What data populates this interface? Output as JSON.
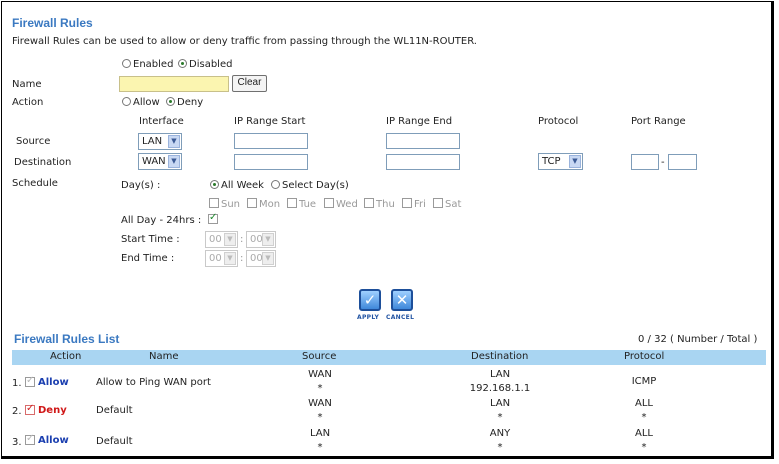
{
  "header": {
    "title": "Firewall Rules",
    "description": "Firewall Rules can be used to allow or deny traffic from passing through the WL11N-ROUTER."
  },
  "status": {
    "enabled_label": "Enabled",
    "disabled_label": "Disabled",
    "selected": "Disabled"
  },
  "name_field": {
    "label": "Name",
    "value": "",
    "clear_label": "Clear"
  },
  "action_field": {
    "label": "Action",
    "allow_label": "Allow",
    "deny_label": "Deny",
    "selected": "Deny"
  },
  "columns": {
    "interface": "Interface",
    "ip_start": "IP Range Start",
    "ip_end": "IP Range End",
    "protocol": "Protocol",
    "port_range": "Port Range"
  },
  "source": {
    "label": "Source",
    "interface": "LAN",
    "ip_start": "",
    "ip_end": ""
  },
  "destination": {
    "label": "Destination",
    "interface": "WAN",
    "ip_start": "",
    "ip_end": "",
    "protocol": "TCP",
    "port_start": "",
    "port_end": "",
    "port_sep": "-"
  },
  "schedule": {
    "label": "Schedule",
    "days_label": "Day(s) :",
    "all_week_label": "All Week",
    "select_days_label": "Select Day(s)",
    "days": [
      "Sun",
      "Mon",
      "Tue",
      "Wed",
      "Thu",
      "Fri",
      "Sat"
    ],
    "all_day_label": "All Day - 24hrs :",
    "start_label": "Start Time :",
    "end_label": "End Time :",
    "time_hour": "00",
    "time_min": "00",
    "time_sep": ":"
  },
  "buttons": {
    "apply": "APPLY",
    "cancel": "CANCEL"
  },
  "list": {
    "title": "Firewall Rules List",
    "count": "0 / 32  ( Number / Total )",
    "headers": {
      "action": "Action",
      "name": "Name",
      "source": "Source",
      "destination": "Destination",
      "protocol": "Protocol"
    },
    "rows": [
      {
        "num": "1.",
        "action": "Allow",
        "name": "Allow to Ping WAN port",
        "source": "WAN",
        "source_ip": "*",
        "dest": "LAN",
        "dest_ip": "192.168.1.1",
        "protocol": "ICMP",
        "protocol_sub": ""
      },
      {
        "num": "2.",
        "action": "Deny",
        "name": "Default",
        "source": "WAN",
        "source_ip": "*",
        "dest": "LAN",
        "dest_ip": "*",
        "protocol": "ALL",
        "protocol_sub": "*"
      },
      {
        "num": "3.",
        "action": "Allow",
        "name": "Default",
        "source": "LAN",
        "source_ip": "*",
        "dest": "ANY",
        "dest_ip": "*",
        "protocol": "ALL",
        "protocol_sub": "*"
      }
    ]
  },
  "colors": {
    "title": "#3b79c1",
    "header_bg": "#a9d5f2",
    "allow": "#1b3fb0",
    "deny": "#d01818"
  }
}
